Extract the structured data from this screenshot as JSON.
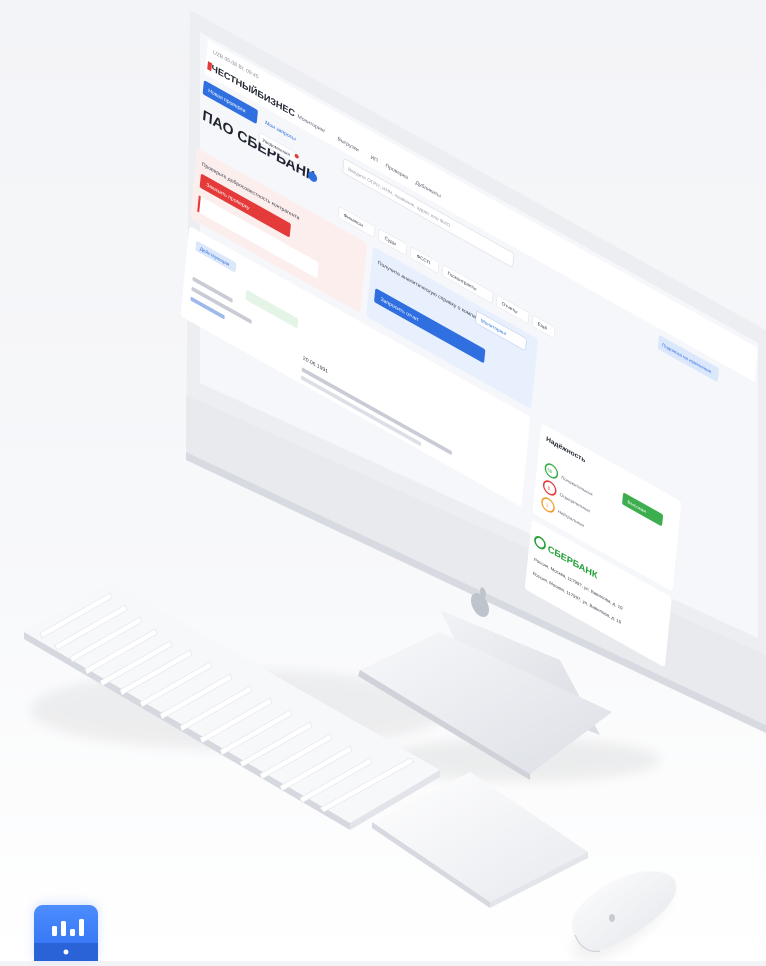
{
  "scene": {
    "description_free": true,
    "colors": {
      "background": "#f4f5f8",
      "monitor_frame": "#e9ebf0",
      "screen_bg": "#f5f6f9",
      "accent_blue": "#2f6fe0",
      "accent_red": "#e43a3a",
      "accent_green": "#3cae4d",
      "accent_orange": "#f29d2a",
      "sber_green": "#21a038"
    }
  },
  "screen": {
    "date_line": "UZB  05.08  Вт, 09:45",
    "logo": "ЧЕСТНЫЙБИЗНЕС",
    "nav": [
      "Мониторинг",
      "Выгрузки",
      "ИП",
      "Проверка",
      "Дубликаты"
    ],
    "search_placeholder": "Введите ОГРН, ИНН, название, адрес или ФИО",
    "company_title": "ПАО СБЕРБАНК",
    "buttons": {
      "new_check": "Новая проверка",
      "my_checks": "Мои запросы",
      "notice": "Уведомления",
      "finance": "Финансы",
      "courts": "Суды",
      "fssp": "ФССП",
      "contracts": "Госконтракты",
      "reports": "Отчеты",
      "more": "Ещё",
      "subscribe": "Подписка на изменения",
      "monitor": "Мониторинг"
    },
    "alerts": {
      "red_banner_text": "Проверьте добросовестность контрагента",
      "red_button": "Заказать проверку",
      "blue_banner_text": "Получите аналитическую справку о компании",
      "blue_button": "Запросить отчет"
    },
    "status": {
      "active_badge": "Действующая",
      "reliability_title": "Надёжность",
      "high_badge": "Высокая",
      "factor_counts": [
        "58",
        "8",
        "3"
      ],
      "factor_labels": [
        "Положительных",
        "Отрицательных",
        "Нейтральных"
      ]
    },
    "sber": {
      "brand": "СБЕРБАНК",
      "address_1": "Россия, Москва, 117997, ул. Вавилова, д. 19",
      "address_2": "Россия, Москва, 117997, ул. Вавилова, д. 19"
    },
    "date_value": "20.06.1991"
  },
  "app_icon": {
    "name": "bar-chart-icon"
  }
}
